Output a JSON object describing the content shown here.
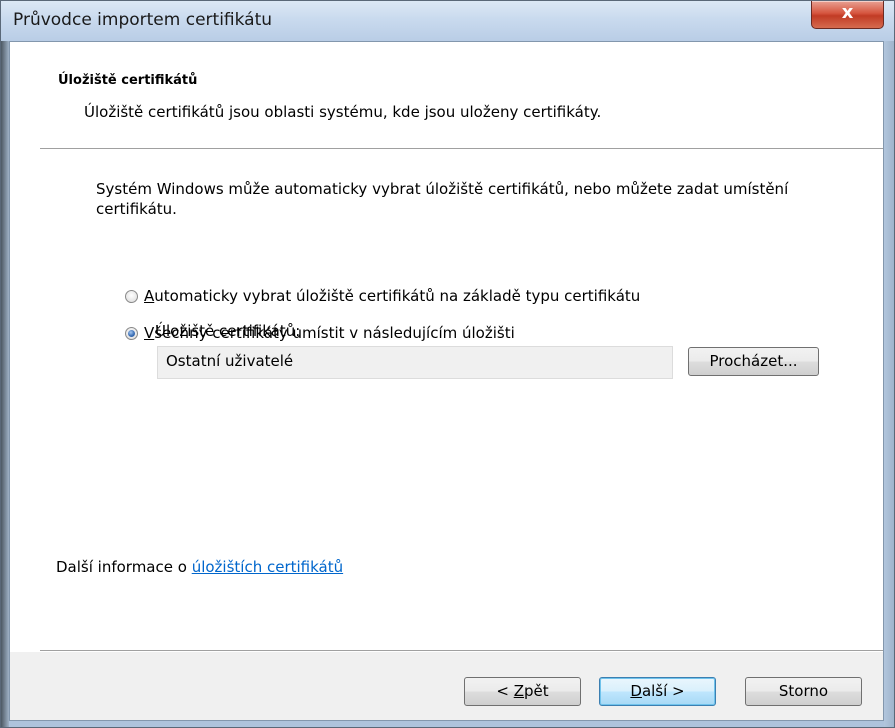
{
  "window": {
    "title": "Průvodce importem certifikátu",
    "close_glyph": "x"
  },
  "header": {
    "title": "Úložiště certifikátů",
    "subtitle": "Úložiště certifikátů jsou oblasti systému, kde jsou uloženy certifikáty."
  },
  "body": {
    "description": "Systém Windows může automaticky vybrat úložiště certifikátů, nebo můžete zadat umístění certifikátu.",
    "radio_auto": {
      "mnemonic": "A",
      "rest": "utomaticky vybrat úložiště certifikátů na základě typu certifikátu",
      "checked": false
    },
    "radio_manual": {
      "mnemonic": "V",
      "rest": "šechny certifikáty umístit v následujícím úložišti",
      "checked": true
    },
    "store_label": "Úložiště certifikátů:",
    "store_value": "Ostatní uživatelé",
    "browse_label": "Procházet...",
    "info_prefix": "Další informace o ",
    "info_link": "úložištích certifikátů"
  },
  "footer": {
    "back_prefix": "< ",
    "back_mnemonic": "Z",
    "back_rest": "pět",
    "next_mnemonic": "D",
    "next_rest": "alší >",
    "cancel_label": "Storno"
  }
}
